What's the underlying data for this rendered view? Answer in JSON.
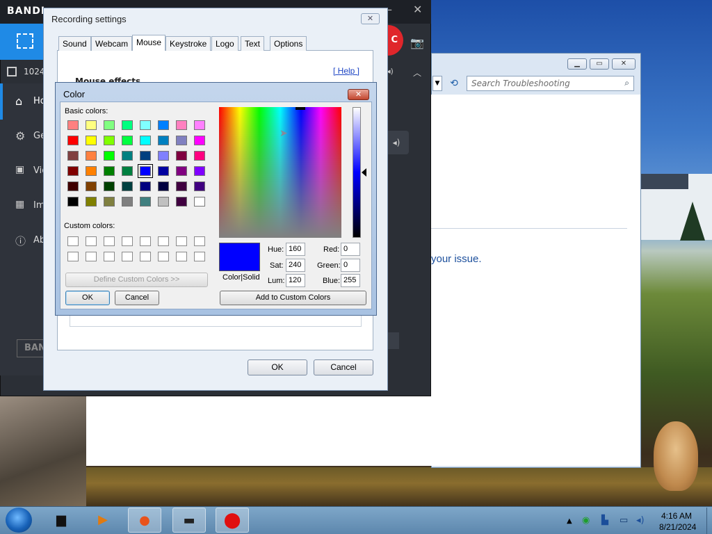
{
  "bandicam": {
    "logo": "BANDI",
    "resolution": "1024x",
    "rec_label": "C",
    "side_items": [
      "Ho",
      "Ge",
      "Vid",
      "Im",
      "Ab"
    ],
    "bottom_logo": "BAN"
  },
  "recording_settings": {
    "title": "Recording settings",
    "tabs": [
      "Sound",
      "Webcam",
      "Mouse",
      "Keystroke",
      "Logo",
      "Text",
      "Options"
    ],
    "active_tab": "Mouse",
    "help_link": "[ Help ]",
    "section_label": "Mouse effects",
    "ok_label": "OK",
    "cancel_label": "Cancel"
  },
  "color_dialog": {
    "title": "Color",
    "basic_colors_label": "Basic colors:",
    "custom_colors_label": "Custom colors:",
    "define_custom_label": "Define Custom Colors >>",
    "ok_label": "OK",
    "cancel_label": "Cancel",
    "add_custom_label": "Add to Custom Colors",
    "color_solid_label": "Color|Solid",
    "hue_label": "Hue:",
    "hue": "160",
    "sat_label": "Sat:",
    "sat": "240",
    "lum_label": "Lum:",
    "lum": "120",
    "red_label": "Red:",
    "red": "0",
    "green_label": "Green:",
    "green": "0",
    "blue_label": "Blue:",
    "blue": "255",
    "selected_color": "#0000ff",
    "basic_colors": [
      [
        "#ff8080",
        "#ffff80",
        "#80ff80",
        "#00ff80",
        "#80ffff",
        "#0080ff",
        "#ff80c0",
        "#ff80ff"
      ],
      [
        "#ff0000",
        "#ffff00",
        "#80ff00",
        "#00ff40",
        "#00ffff",
        "#0080c0",
        "#8080c0",
        "#ff00ff"
      ],
      [
        "#804040",
        "#ff8040",
        "#00ff00",
        "#008080",
        "#004080",
        "#8080ff",
        "#800040",
        "#ff0080"
      ],
      [
        "#800000",
        "#ff8000",
        "#008000",
        "#008040",
        "#0000ff",
        "#0000a0",
        "#800080",
        "#8000ff"
      ],
      [
        "#400000",
        "#804000",
        "#004000",
        "#004040",
        "#000080",
        "#000040",
        "#400040",
        "#400080"
      ],
      [
        "#000000",
        "#808000",
        "#808040",
        "#808080",
        "#408080",
        "#c0c0c0",
        "#400040",
        "#ffffff"
      ]
    ]
  },
  "troubleshooting": {
    "search_placeholder": "Search Troubleshooting",
    "issue_text": "your issue."
  },
  "taskbar": {
    "time": "4:16 AM",
    "date": "8/21/2024"
  }
}
